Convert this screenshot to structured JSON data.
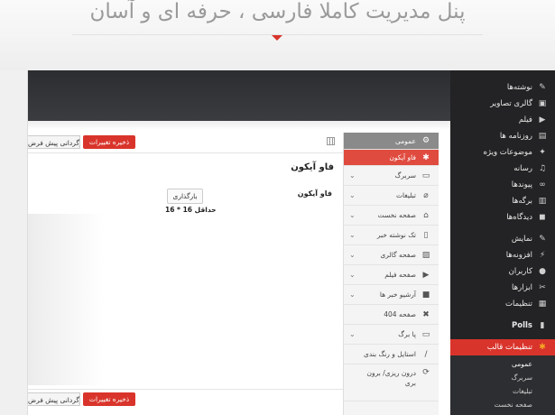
{
  "banner": {
    "headline": "پنل مدیریت کاملا فارسی ، حرفه ای و آسان"
  },
  "admin_menu": {
    "items": [
      {
        "label": "نوشته‌ها",
        "icon": "pin-icon",
        "glyph": "✎"
      },
      {
        "label": "گالری تصاویر",
        "icon": "gallery-icon",
        "glyph": "▣"
      },
      {
        "label": "فیلم",
        "icon": "film-icon",
        "glyph": "▶"
      },
      {
        "label": "روزنامه ها",
        "icon": "newspaper-icon",
        "glyph": "▤"
      },
      {
        "label": "موضوعات ویژه",
        "icon": "featured-icon",
        "glyph": "✦"
      },
      {
        "label": "رسانه",
        "icon": "media-icon",
        "glyph": "♫"
      },
      {
        "label": "پیوندها",
        "icon": "link-icon",
        "glyph": "∞"
      },
      {
        "label": "برگه‌ها",
        "icon": "pages-icon",
        "glyph": "▥"
      },
      {
        "label": "دیدگاه‌ها",
        "icon": "comments-icon",
        "glyph": "◼"
      }
    ],
    "items2": [
      {
        "label": "نمایش",
        "icon": "appearance-icon",
        "glyph": "✎"
      },
      {
        "label": "افزونه‌ها",
        "icon": "plugins-icon",
        "glyph": "⚡"
      },
      {
        "label": "کاربران",
        "icon": "users-icon",
        "glyph": "●"
      },
      {
        "label": "ابزارها",
        "icon": "tools-icon",
        "glyph": "✂"
      },
      {
        "label": "تنظیمات",
        "icon": "settings-icon",
        "glyph": "▦"
      }
    ],
    "polls": {
      "label": "Polls",
      "glyph": "▮"
    },
    "theme_settings": {
      "label": "تنظیمات قالب",
      "glyph": "✱"
    },
    "sub_items": [
      "عمومی",
      "سربرگ",
      "تبلیغات",
      "صفحه نخست"
    ]
  },
  "options_nav": {
    "general": "عمومی",
    "favicon": "فاو آیکون",
    "sections": [
      {
        "label": "سربرگ",
        "glyph": "▭"
      },
      {
        "label": "تبلیغات",
        "glyph": "⌀"
      },
      {
        "label": "صفحه نخست",
        "glyph": "⌂"
      },
      {
        "label": "تک نوشته خبر",
        "glyph": "▯"
      },
      {
        "label": "صفحه گالری",
        "glyph": "▨"
      },
      {
        "label": "صفحه فیلم",
        "glyph": "▶"
      },
      {
        "label": "آرشیو خبر ها",
        "glyph": "■"
      },
      {
        "label": "صفحه 404",
        "glyph": "✖"
      },
      {
        "label": "پا برگ",
        "glyph": "▭"
      },
      {
        "label": "استایل و رنگ بندی",
        "glyph": "/"
      },
      {
        "label": "درون ریزی/ برون بری",
        "glyph": "⟳"
      }
    ]
  },
  "content": {
    "save_label": "ذخیره تغییرات",
    "reset_label": "بازگردانی پیش فرض",
    "section_title": "فاو آیکون",
    "field_label": "فاو آیکون",
    "upload_label": "بارگذاری",
    "size_hint": "حداقل 16 * 16"
  }
}
